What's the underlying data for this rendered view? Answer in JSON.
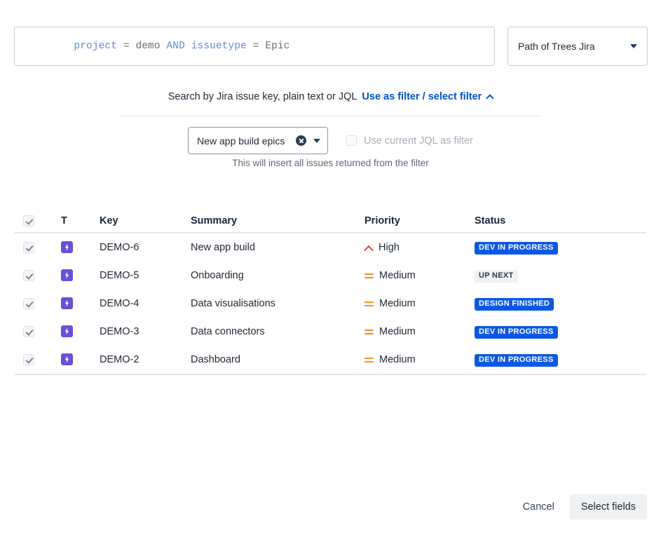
{
  "jql": {
    "tokens": [
      {
        "text": "project",
        "kind": "kw"
      },
      {
        "text": " = ",
        "kind": "op"
      },
      {
        "text": "demo",
        "kind": "val"
      },
      {
        "text": " ",
        "kind": "op"
      },
      {
        "text": "AND",
        "kind": "kw"
      },
      {
        "text": " ",
        "kind": "op"
      },
      {
        "text": "issuetype",
        "kind": "kw"
      },
      {
        "text": " = ",
        "kind": "op"
      },
      {
        "text": "Epic",
        "kind": "val"
      }
    ],
    "plain": "project = demo AND issuetype = Epic"
  },
  "project_select": {
    "value": "Path of Trees Jira",
    "chevron": "chevron-down-icon"
  },
  "search": {
    "hint": "Search by Jira issue key, plain text or JQL",
    "link_label": "Use as filter / select filter",
    "link_chevron": "chevron-up-icon",
    "link_color": "#0052cc"
  },
  "filter": {
    "selected": "New app build epics",
    "clear_icon": "clear-circle-icon",
    "chevron": "chevron-down-icon",
    "use_current_jql_label": "Use current JQL as filter",
    "use_current_jql_checked": false,
    "use_current_jql_disabled": true,
    "helper_text": "This will insert all issues returned from the filter"
  },
  "table": {
    "select_all_checked": true,
    "headers": {
      "type": "T",
      "key": "Key",
      "summary": "Summary",
      "priority": "Priority",
      "status": "Status"
    },
    "rows": [
      {
        "checked": true,
        "type_icon": "epic-icon",
        "key": "DEMO-6",
        "summary": "New app build",
        "priority": "High",
        "priority_icon": "priority-high-icon",
        "status": "DEV IN PROGRESS",
        "status_style": "blue"
      },
      {
        "checked": true,
        "type_icon": "epic-icon",
        "key": "DEMO-5",
        "summary": "Onboarding",
        "priority": "Medium",
        "priority_icon": "priority-medium-icon",
        "status": "UP NEXT",
        "status_style": "grey"
      },
      {
        "checked": true,
        "type_icon": "epic-icon",
        "key": "DEMO-4",
        "summary": "Data visualisations",
        "priority": "Medium",
        "priority_icon": "priority-medium-icon",
        "status": "DESIGN FINISHED",
        "status_style": "blue"
      },
      {
        "checked": true,
        "type_icon": "epic-icon",
        "key": "DEMO-3",
        "summary": "Data connectors",
        "priority": "Medium",
        "priority_icon": "priority-medium-icon",
        "status": "DEV IN PROGRESS",
        "status_style": "blue"
      },
      {
        "checked": true,
        "type_icon": "epic-icon",
        "key": "DEMO-2",
        "summary": "Dashboard",
        "priority": "Medium",
        "priority_icon": "priority-medium-icon",
        "status": "DEV IN PROGRESS",
        "status_style": "blue"
      }
    ]
  },
  "footer": {
    "cancel_label": "Cancel",
    "submit_label": "Select fields"
  },
  "colors": {
    "link": "#0052cc",
    "badge_blue_bg": "#0c58e5",
    "badge_grey_bg": "#f0f1f3",
    "epic_purple": "#6b4fd8",
    "priority_high": "#e2483d",
    "priority_medium": "#f5911e"
  }
}
